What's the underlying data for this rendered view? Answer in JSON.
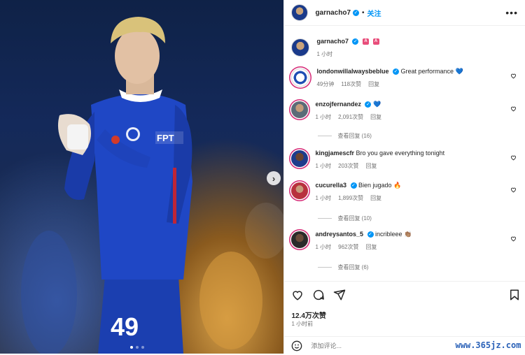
{
  "header": {
    "username": "garnacho7",
    "follow_label": "关注",
    "more_label": "•••"
  },
  "caption": {
    "username": "garnacho7",
    "badges": [
      "A",
      "A"
    ],
    "time": "1 小时"
  },
  "comments": [
    {
      "username": "londonwillalwaysbeblue",
      "verified": true,
      "text": "Great performance 💙",
      "time": "49分钟",
      "likes": "118次赞",
      "reply": "回复"
    },
    {
      "username": "enzojfernandez",
      "verified": true,
      "text": "💙",
      "time": "1 小时",
      "likes": "2,091次赞",
      "reply": "回复",
      "view_replies": "查看回复 (16)"
    },
    {
      "username": "kingjamescfr",
      "verified": false,
      "text": "Bro you gave everything tonight",
      "time": "1 小时",
      "likes": "203次赞",
      "reply": "回复"
    },
    {
      "username": "cucurella3",
      "verified": true,
      "text": "Bien jugado 🔥",
      "time": "1 小时",
      "likes": "1,899次赞",
      "reply": "回复",
      "view_replies": "查看回复 (10)"
    },
    {
      "username": "andreysantos_5",
      "verified": true,
      "text": "incribleee 👏🏽",
      "time": "1 小时",
      "likes": "962次赞",
      "reply": "回复",
      "view_replies": "查看回复 (6)"
    }
  ],
  "post": {
    "likes": "12.4万次赞",
    "time": "1 小时前",
    "add_comment_placeholder": "添加评论..."
  },
  "photo": {
    "jersey_sponsor": "FPT",
    "jersey_number": "49"
  },
  "watermark": "www.365jz.com",
  "colors": {
    "accent": "#0095f6",
    "heart": "#2f6fd6",
    "jersey": "#1f47c5"
  }
}
